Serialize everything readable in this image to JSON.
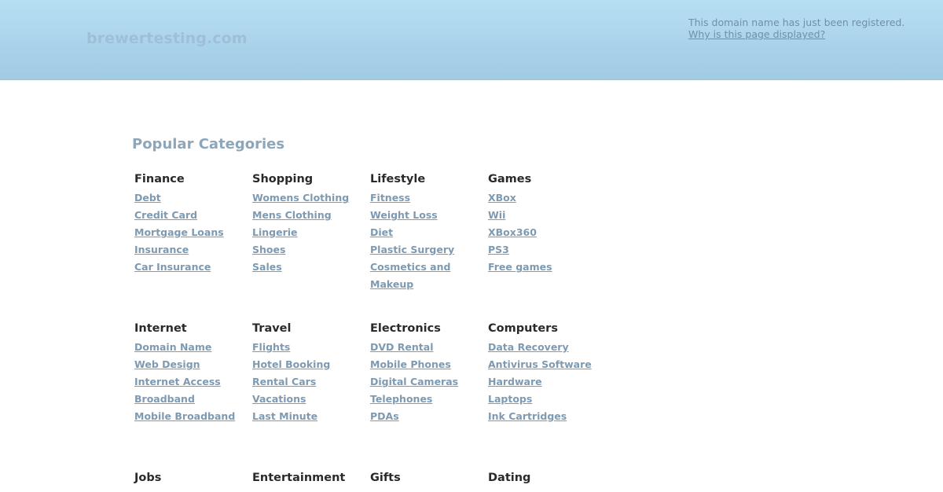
{
  "header": {
    "site_name": "brewertesting.com",
    "notice_text": "This domain name has just been registered.",
    "notice_link": "Why is this page displayed?"
  },
  "main": {
    "title": "Popular Categories",
    "categories": [
      {
        "heading": "Finance",
        "links": [
          "Debt",
          "Credit Card",
          "Mortgage Loans",
          "Insurance",
          "Car Insurance"
        ]
      },
      {
        "heading": "Shopping",
        "links": [
          "Womens Clothing",
          "Mens Clothing",
          "Lingerie",
          "Shoes",
          "Sales"
        ]
      },
      {
        "heading": "Lifestyle",
        "links": [
          "Fitness",
          "Weight Loss",
          "Diet",
          "Plastic Surgery",
          "Cosmetics and Makeup"
        ]
      },
      {
        "heading": "Games",
        "links": [
          "XBox",
          "Wii",
          "XBox360",
          "PS3",
          "Free games"
        ]
      },
      {
        "heading": "Internet",
        "links": [
          "Domain Name",
          "Web Design",
          "Internet Access",
          "Broadband",
          "Mobile Broadband"
        ]
      },
      {
        "heading": "Travel",
        "links": [
          "Flights",
          "Hotel Booking",
          "Rental Cars",
          "Vacations",
          "Last Minute"
        ]
      },
      {
        "heading": "Electronics",
        "links": [
          "DVD Rental",
          "Mobile Phones",
          "Digital Cameras",
          "Telephones",
          "PDAs"
        ]
      },
      {
        "heading": "Computers",
        "links": [
          "Data Recovery",
          "Antivirus Software",
          "Hardware",
          "Laptops",
          "Ink Cartridges"
        ]
      },
      {
        "heading": "Jobs",
        "links": []
      },
      {
        "heading": "Entertainment",
        "links": []
      },
      {
        "heading": "Gifts",
        "links": []
      },
      {
        "heading": "Dating",
        "links": []
      }
    ]
  },
  "colors": {
    "header_bg": "#b7dff3",
    "site_name": "#9fbfd8",
    "link": "#7d9ab2",
    "heading": "#2a2a2a",
    "title": "#8ea6b9"
  }
}
